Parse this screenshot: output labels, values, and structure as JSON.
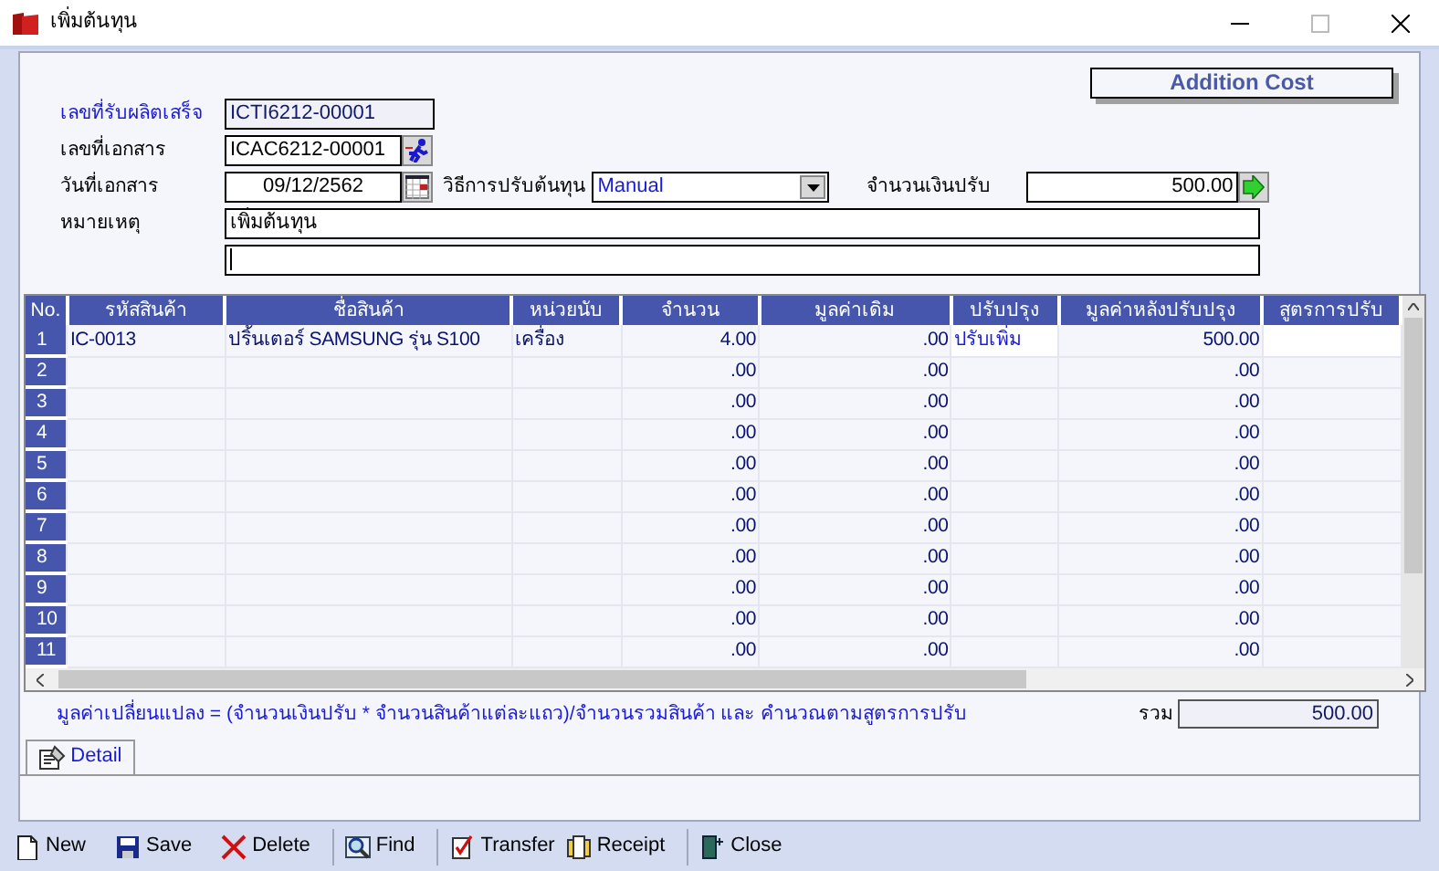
{
  "window": {
    "title": "เพิ่มต้นทุน"
  },
  "header_button": "Addition Cost",
  "form": {
    "received_no": {
      "label": "เลขที่รับผลิตเสร็จ",
      "value": "ICTI6212-00001"
    },
    "doc_no": {
      "label": "เลขที่เอกสาร",
      "value": "ICAC6212-00001"
    },
    "doc_date": {
      "label": "วันที่เอกสาร",
      "value": "09/12/2562"
    },
    "method": {
      "label": "วิธีการปรับต้นทุน",
      "value": "Manual"
    },
    "amount": {
      "label": "จำนวนเงินปรับ",
      "value": "500.00"
    },
    "note": {
      "label": "หมายเหตุ",
      "value": "เพิ่มต้นทุน"
    }
  },
  "grid": {
    "columns": [
      "No.",
      "รหัสสินค้า",
      "ชื่อสินค้า",
      "หน่วยนับ",
      "จำนวน",
      "มูลค่าเดิม",
      "ปรับปรุง",
      "มูลค่าหลังปรับปรุง",
      "สูตรการปรับ"
    ],
    "rows": [
      {
        "no": "1",
        "code": "IC-0013",
        "name": "ปริ้นเตอร์ SAMSUNG  รุ่น S100",
        "unit": "เครื่อง",
        "qty": "4.00",
        "original": ".00",
        "adjust": "ปรับเพิ่ม",
        "after": "500.00"
      },
      {
        "no": "2",
        "qty": ".00",
        "original": ".00",
        "after": ".00"
      },
      {
        "no": "3",
        "qty": ".00",
        "original": ".00",
        "after": ".00"
      },
      {
        "no": "4",
        "qty": ".00",
        "original": ".00",
        "after": ".00"
      },
      {
        "no": "5",
        "qty": ".00",
        "original": ".00",
        "after": ".00"
      },
      {
        "no": "6",
        "qty": ".00",
        "original": ".00",
        "after": ".00"
      },
      {
        "no": "7",
        "qty": ".00",
        "original": ".00",
        "after": ".00"
      },
      {
        "no": "8",
        "qty": ".00",
        "original": ".00",
        "after": ".00"
      },
      {
        "no": "9",
        "qty": ".00",
        "original": ".00",
        "after": ".00"
      },
      {
        "no": "10",
        "qty": ".00",
        "original": ".00",
        "after": ".00"
      },
      {
        "no": "11",
        "qty": ".00",
        "original": ".00",
        "after": ".00"
      }
    ]
  },
  "formula_note": "มูลค่าเปลี่ยนแปลง = (จำนวนเงินปรับ * จำนวนสินค้าแต่ละแถว)/จำนวนรวมสินค้า และ คำนวณตามสูตรการปรับ",
  "total": {
    "label": "รวม",
    "value": "500.00"
  },
  "tabs": [
    {
      "label": "Detail",
      "selected": true
    }
  ],
  "toolbar": [
    {
      "kind": "new",
      "label": "New"
    },
    {
      "kind": "save",
      "label": "Save"
    },
    {
      "kind": "delete",
      "label": "Delete"
    },
    {
      "kind": "find",
      "label": "Find"
    },
    {
      "kind": "transfer",
      "label": "Transfer"
    },
    {
      "kind": "receipt",
      "label": "Receipt"
    },
    {
      "kind": "close",
      "label": "Close"
    }
  ]
}
